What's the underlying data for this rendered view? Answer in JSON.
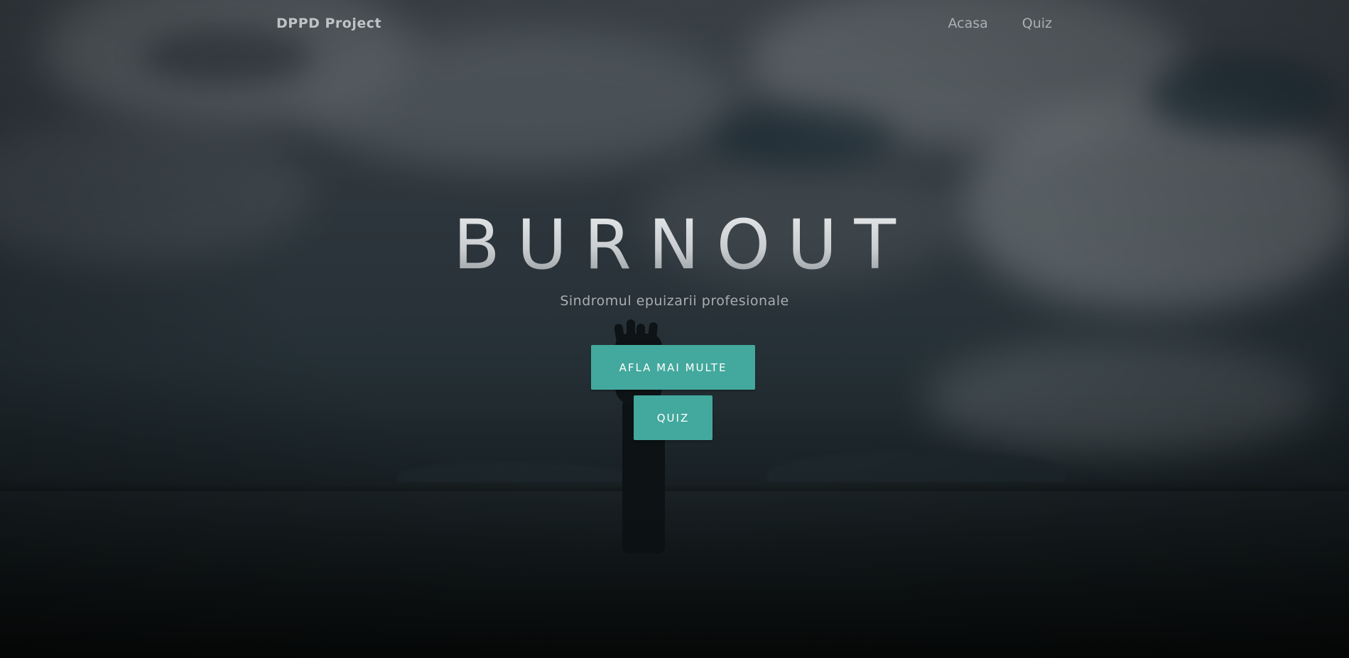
{
  "nav": {
    "brand": "DPPD Project",
    "links": [
      {
        "label": "Acasa"
      },
      {
        "label": "Quiz"
      }
    ]
  },
  "hero": {
    "title": "BURNOUT",
    "subtitle": "Sindromul epuizarii profesionale",
    "buttons": {
      "learn_more": "AFLA MAI MULTE",
      "quiz": "QUIZ"
    }
  },
  "colors": {
    "accent": "#43a89d",
    "background_dark": "#0d1216"
  }
}
